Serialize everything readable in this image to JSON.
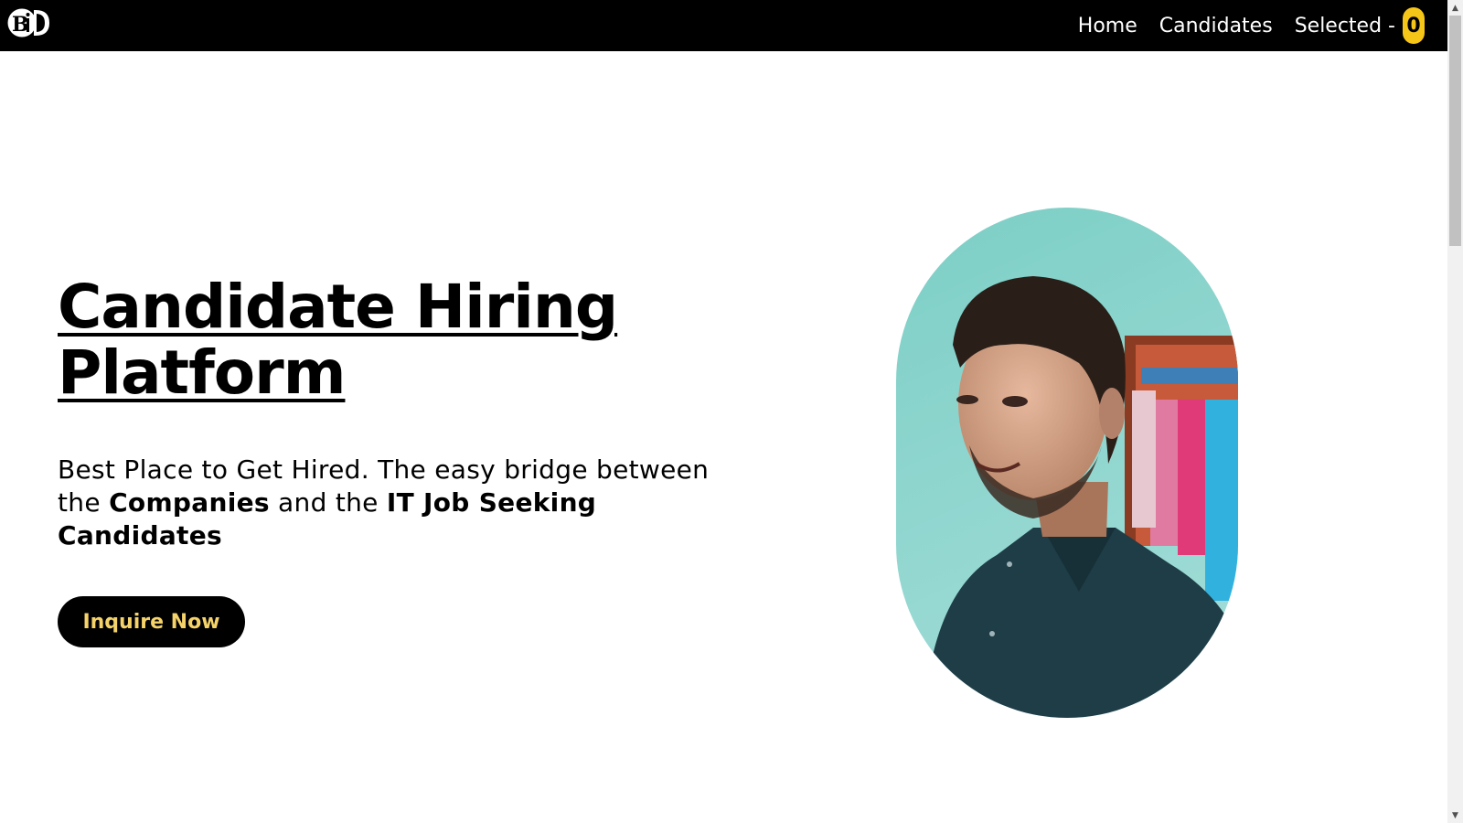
{
  "nav": {
    "logo_text": "BiD",
    "home_label": "Home",
    "candidates_label": "Candidates",
    "selected_label": "Selected -",
    "selected_count": "0"
  },
  "hero": {
    "title": "Candidate Hiring Platform",
    "subtitle_part1": "Best Place to Get Hired. The easy bridge between the ",
    "subtitle_bold1": "Companies",
    "subtitle_part2": " and the ",
    "subtitle_bold2": "IT Job Seeking Candidates",
    "cta_label": "Inquire Now"
  },
  "colors": {
    "nav_bg": "#000000",
    "badge_bg": "#f5c518",
    "cta_text": "#f5d36a"
  },
  "icons": {
    "scroll_up": "scroll-up-arrow-icon",
    "scroll_down": "scroll-down-arrow-icon"
  }
}
